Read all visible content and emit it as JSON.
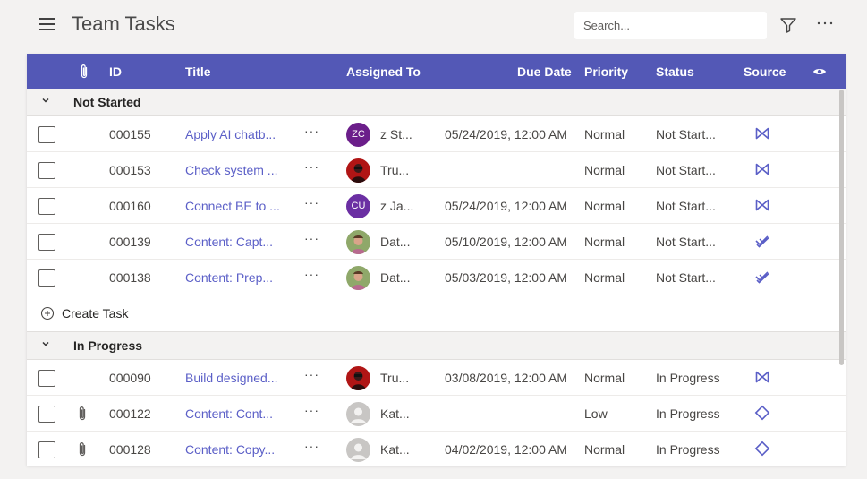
{
  "app": {
    "title": "Team Tasks",
    "search_placeholder": "Search...",
    "filter_icon": "filter-icon",
    "more_icon": "more-horizontal-icon"
  },
  "columns": {
    "attachment_icon": "paperclip-icon",
    "id": "ID",
    "title": "Title",
    "assigned_to": "Assigned To",
    "due_date": "Due Date",
    "priority": "Priority",
    "status": "Status",
    "source": "Source",
    "view_icon": "eye-icon"
  },
  "colors": {
    "header_bg": "#5358b6",
    "link": "#5b5fc7",
    "avatar_zc": "#6b1e8a",
    "avatar_cu": "#6b2fa3"
  },
  "groups": [
    {
      "name": "Not Started",
      "rows": [
        {
          "id": "000155",
          "title": "Apply AI chatb...",
          "more": "···",
          "avatar": "ZC",
          "assignee": "z St...",
          "due": "05/24/2019, 12:00 AM",
          "priority": "Normal",
          "status": "Not Start...",
          "source": "visual-studio-icon"
        },
        {
          "id": "000153",
          "title": "Check system ...",
          "more": "···",
          "avatar": "",
          "assignee": "Tru...",
          "due": "",
          "priority": "Normal",
          "status": "Not Start...",
          "source": "visual-studio-icon"
        },
        {
          "id": "000160",
          "title": "Connect BE to ...",
          "more": "···",
          "avatar": "CU",
          "assignee": "z Ja...",
          "due": "05/24/2019, 12:00 AM",
          "priority": "Normal",
          "status": "Not Start...",
          "source": "visual-studio-icon"
        },
        {
          "id": "000139",
          "title": "Content: Capt...",
          "more": "···",
          "avatar": "",
          "assignee": "Dat...",
          "due": "05/10/2019, 12:00 AM",
          "priority": "Normal",
          "status": "Not Start...",
          "source": "planner-icon"
        },
        {
          "id": "000138",
          "title": "Content: Prep...",
          "more": "···",
          "avatar": "",
          "assignee": "Dat...",
          "due": "05/03/2019, 12:00 AM",
          "priority": "Normal",
          "status": "Not Start...",
          "source": "planner-icon"
        }
      ],
      "create_label": "Create Task"
    },
    {
      "name": "In Progress",
      "rows": [
        {
          "id": "000090",
          "title": "Build designed...",
          "more": "···",
          "avatar": "",
          "assignee": "Tru...",
          "due": "03/08/2019, 12:00 AM",
          "priority": "Normal",
          "status": "In Progress",
          "source": "visual-studio-icon"
        },
        {
          "id": "000122",
          "title": "Content: Cont...",
          "more": "···",
          "avatar": "",
          "assignee": "Kat...",
          "due": "",
          "priority": "Low",
          "status": "In Progress",
          "source": "diamond-icon"
        },
        {
          "id": "000128",
          "title": "Content: Copy...",
          "more": "···",
          "avatar": "",
          "assignee": "Kat...",
          "due": "04/02/2019, 12:00 AM",
          "priority": "Normal",
          "status": "In Progress",
          "source": "diamond-icon"
        }
      ]
    }
  ]
}
